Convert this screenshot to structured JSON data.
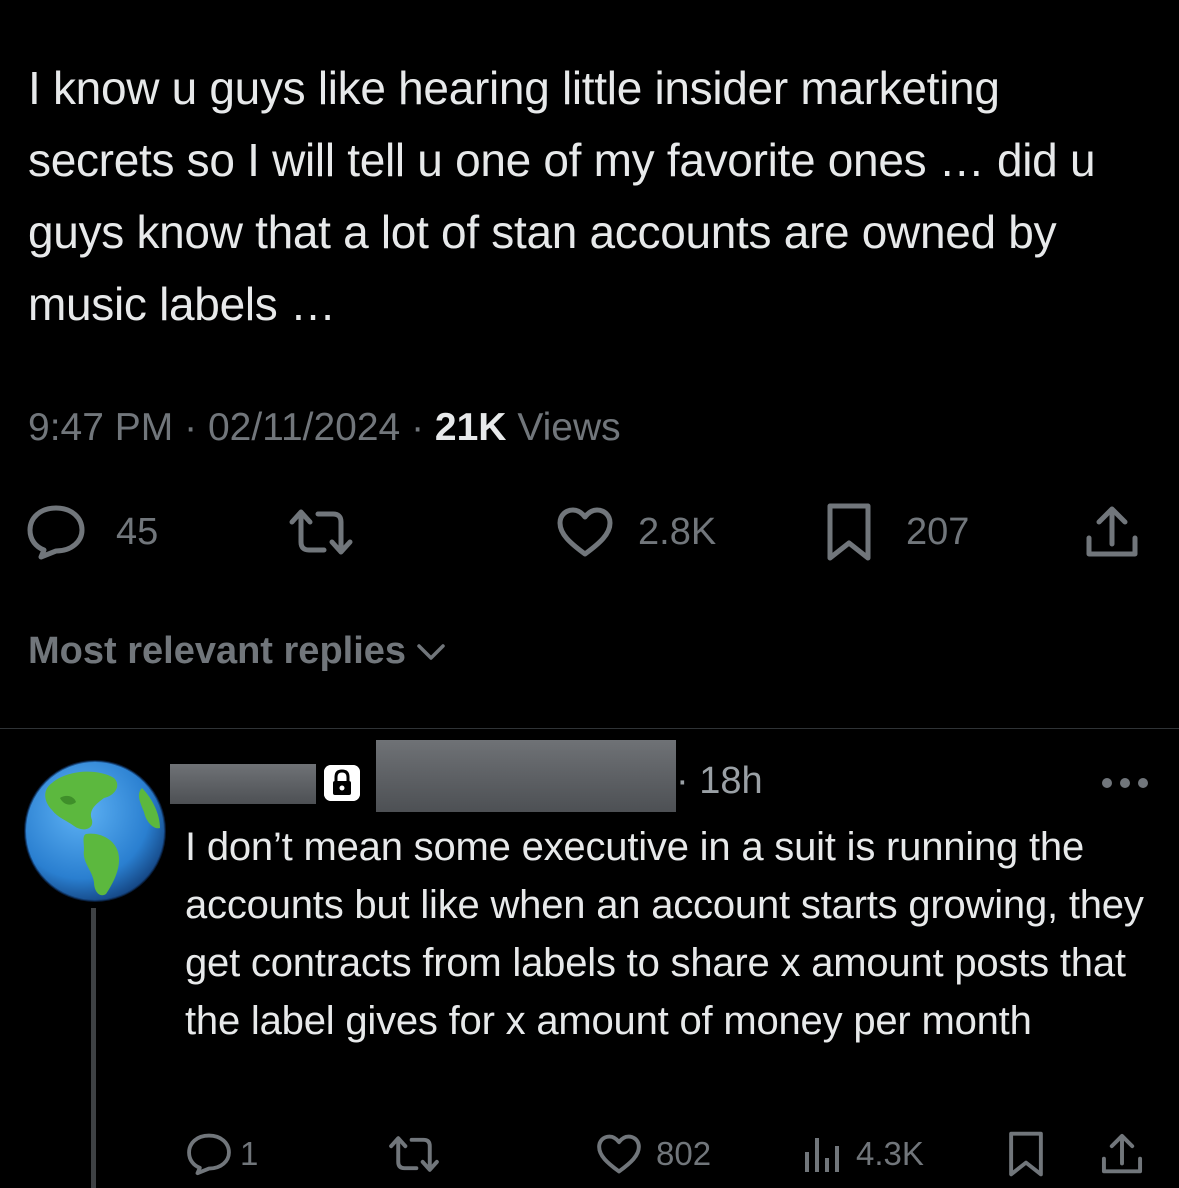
{
  "tweet": {
    "text": "I know u guys like hearing little insider marketing secrets so I will tell u one of my favorite ones … did u guys know that a lot of stan accounts are owned by music labels …",
    "time": "9:47 PM",
    "separator": "·",
    "date": "02/11/2024",
    "views_count": "21K",
    "views_label": "Views",
    "replies": "45",
    "likes": "2.8K",
    "bookmarks": "207"
  },
  "replies_sort": {
    "label": "Most relevant replies"
  },
  "reply": {
    "time": "· 18h",
    "text": "I don’t mean some executive in a suit is running the accounts but like when an account starts growing, they get contracts from labels to share x amount posts that the label gives for x amount of money per month",
    "replies": "1",
    "likes": "802",
    "views": "4.3K"
  },
  "icons": {
    "reply": "reply-bubble-icon",
    "retweet": "retweet-icon",
    "like": "heart-icon",
    "bookmark": "bookmark-icon",
    "share": "share-icon",
    "views": "views-bar-icon",
    "more": "more-dots-icon",
    "lock": "lock-icon",
    "chevron": "chevron-down-icon",
    "avatar": "globe-avatar"
  },
  "colors": {
    "background": "#000000",
    "text": "#e7e9ea",
    "muted": "#71767b",
    "divider": "#2f3336"
  }
}
